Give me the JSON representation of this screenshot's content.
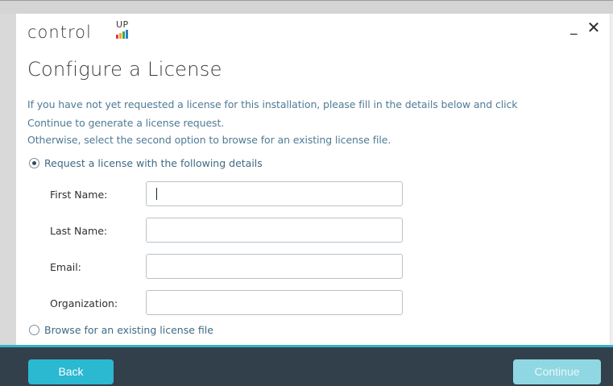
{
  "brand": {
    "word": "control",
    "up": "UP",
    "bar_colors": [
      "#e23b3b",
      "#f2a531",
      "#42a546",
      "#2c7fd0",
      "#8a4fc4"
    ]
  },
  "window": {
    "minimize_icon": "_",
    "close_icon": "✕"
  },
  "title": "Configure a License",
  "description": {
    "line1": "If you have not yet requested a license for this installation, please fill in the details below and click",
    "line2": "Continue to generate a license request.",
    "line3": "Otherwise, select the second option to browse for an existing license file."
  },
  "options": {
    "request_label": "Request a license with the following details",
    "request_selected": true,
    "browse_label": "Browse for an existing license file",
    "browse_selected": false
  },
  "fields": {
    "first_name": {
      "label": "First Name:",
      "value": ""
    },
    "last_name": {
      "label": "Last Name:",
      "value": ""
    },
    "email": {
      "label": "Email:",
      "value": ""
    },
    "organization": {
      "label": "Organization:",
      "value": ""
    }
  },
  "footer": {
    "back_label": "Back",
    "continue_label": "Continue",
    "accent_color": "#35b3c9"
  }
}
